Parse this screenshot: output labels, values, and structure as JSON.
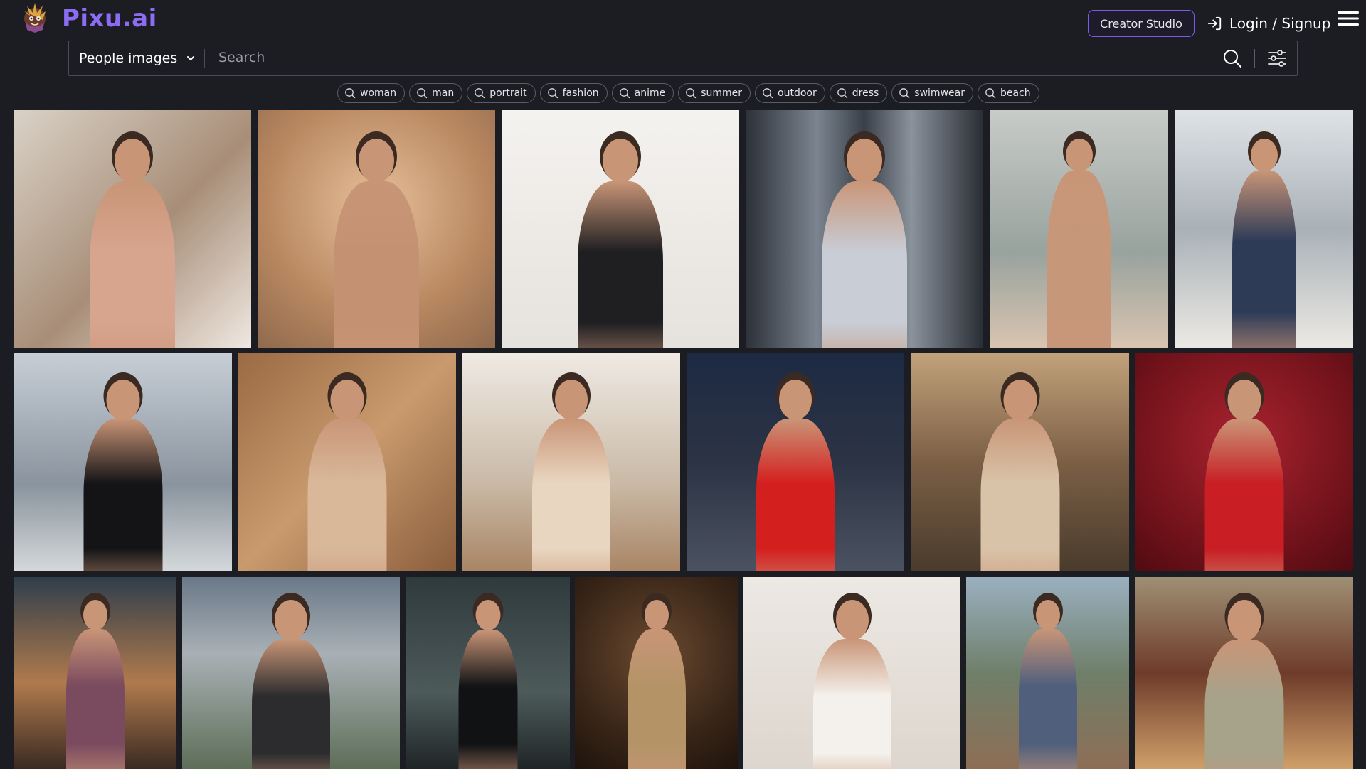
{
  "header": {
    "brand": "Pixu.ai",
    "creator_studio_label": "Creator Studio",
    "login_label": "Login / Signup"
  },
  "search": {
    "category": "People images",
    "placeholder": "Search",
    "value": ""
  },
  "tags": [
    "woman",
    "man",
    "portrait",
    "fashion",
    "anime",
    "summer",
    "outdoor",
    "dress",
    "swimwear",
    "beach"
  ],
  "colors": {
    "background": "#1b1d23",
    "brand": "#8c6cf2",
    "accent_border": "#7c5ce6"
  }
}
